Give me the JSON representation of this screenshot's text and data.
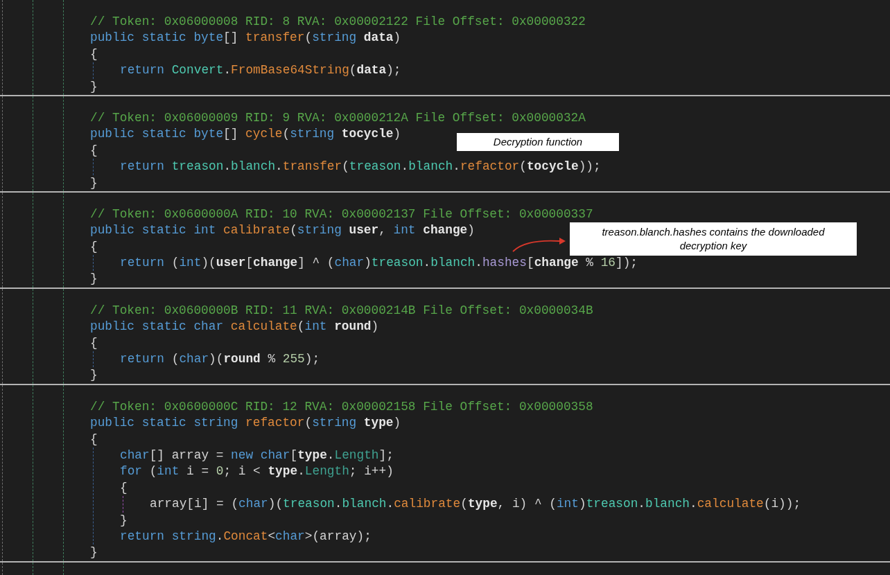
{
  "methods": [
    {
      "comment": "// Token: 0x06000008 RID: 8 RVA: 0x00002122 File Offset: 0x00000322",
      "signature": [
        {
          "kind": "kw",
          "text": "public static byte"
        },
        {
          "kind": "plain",
          "text": "[] "
        },
        {
          "kind": "method",
          "text": "transfer"
        },
        {
          "kind": "plain",
          "text": "("
        },
        {
          "kind": "kw",
          "text": "string "
        },
        {
          "kind": "param",
          "text": "data"
        },
        {
          "kind": "plain",
          "text": ")"
        }
      ],
      "open": "{",
      "close": "}",
      "body": [
        {
          "tokens": [
            {
              "kind": "kw",
              "text": "return "
            },
            {
              "kind": "type",
              "text": "Convert"
            },
            {
              "kind": "plain",
              "text": "."
            },
            {
              "kind": "method",
              "text": "FromBase64String"
            },
            {
              "kind": "plain",
              "text": "("
            },
            {
              "kind": "param",
              "text": "data"
            },
            {
              "kind": "plain",
              "text": ");"
            }
          ]
        }
      ]
    },
    {
      "comment": "// Token: 0x06000009 RID: 9 RVA: 0x0000212A File Offset: 0x0000032A",
      "signature": [
        {
          "kind": "kw",
          "text": "public static byte"
        },
        {
          "kind": "plain",
          "text": "[] "
        },
        {
          "kind": "method",
          "text": "cycle"
        },
        {
          "kind": "plain",
          "text": "("
        },
        {
          "kind": "kw",
          "text": "string "
        },
        {
          "kind": "param",
          "text": "tocycle"
        },
        {
          "kind": "plain",
          "text": ")"
        }
      ],
      "open": "{",
      "close": "}",
      "body": [
        {
          "tokens": [
            {
              "kind": "kw",
              "text": "return "
            },
            {
              "kind": "type",
              "text": "treason"
            },
            {
              "kind": "plain",
              "text": "."
            },
            {
              "kind": "type",
              "text": "blanch"
            },
            {
              "kind": "plain",
              "text": "."
            },
            {
              "kind": "method",
              "text": "transfer"
            },
            {
              "kind": "plain",
              "text": "("
            },
            {
              "kind": "type",
              "text": "treason"
            },
            {
              "kind": "plain",
              "text": "."
            },
            {
              "kind": "type",
              "text": "blanch"
            },
            {
              "kind": "plain",
              "text": "."
            },
            {
              "kind": "method",
              "text": "refactor"
            },
            {
              "kind": "plain",
              "text": "("
            },
            {
              "kind": "param",
              "text": "tocycle"
            },
            {
              "kind": "plain",
              "text": "));"
            }
          ]
        }
      ]
    },
    {
      "comment": "// Token: 0x0600000A RID: 10 RVA: 0x00002137 File Offset: 0x00000337",
      "signature": [
        {
          "kind": "kw",
          "text": "public static int "
        },
        {
          "kind": "method",
          "text": "calibrate"
        },
        {
          "kind": "plain",
          "text": "("
        },
        {
          "kind": "kw",
          "text": "string "
        },
        {
          "kind": "param",
          "text": "user"
        },
        {
          "kind": "plain",
          "text": ", "
        },
        {
          "kind": "kw",
          "text": "int "
        },
        {
          "kind": "param",
          "text": "change"
        },
        {
          "kind": "plain",
          "text": ")"
        }
      ],
      "open": "{",
      "close": "}",
      "body": [
        {
          "tokens": [
            {
              "kind": "kw",
              "text": "return"
            },
            {
              "kind": "plain",
              "text": " ("
            },
            {
              "kind": "kw",
              "text": "int"
            },
            {
              "kind": "plain",
              "text": ")("
            },
            {
              "kind": "param",
              "text": "user"
            },
            {
              "kind": "plain",
              "text": "["
            },
            {
              "kind": "param",
              "text": "change"
            },
            {
              "kind": "plain",
              "text": "] ^ ("
            },
            {
              "kind": "kw",
              "text": "char"
            },
            {
              "kind": "plain",
              "text": ")"
            },
            {
              "kind": "type",
              "text": "treason"
            },
            {
              "kind": "plain",
              "text": "."
            },
            {
              "kind": "type",
              "text": "blanch"
            },
            {
              "kind": "plain",
              "text": "."
            },
            {
              "kind": "field",
              "text": "hashes"
            },
            {
              "kind": "plain",
              "text": "["
            },
            {
              "kind": "param",
              "text": "change"
            },
            {
              "kind": "plain",
              "text": " % "
            },
            {
              "kind": "num",
              "text": "16"
            },
            {
              "kind": "plain",
              "text": "]);"
            }
          ]
        }
      ]
    },
    {
      "comment": "// Token: 0x0600000B RID: 11 RVA: 0x0000214B File Offset: 0x0000034B",
      "signature": [
        {
          "kind": "kw",
          "text": "public static char "
        },
        {
          "kind": "method",
          "text": "calculate"
        },
        {
          "kind": "plain",
          "text": "("
        },
        {
          "kind": "kw",
          "text": "int "
        },
        {
          "kind": "param",
          "text": "round"
        },
        {
          "kind": "plain",
          "text": ")"
        }
      ],
      "open": "{",
      "close": "}",
      "body": [
        {
          "tokens": [
            {
              "kind": "kw",
              "text": "return"
            },
            {
              "kind": "plain",
              "text": " ("
            },
            {
              "kind": "kw",
              "text": "char"
            },
            {
              "kind": "plain",
              "text": ")("
            },
            {
              "kind": "param",
              "text": "round"
            },
            {
              "kind": "plain",
              "text": " % "
            },
            {
              "kind": "num",
              "text": "255"
            },
            {
              "kind": "plain",
              "text": ");"
            }
          ]
        }
      ]
    },
    {
      "comment": "// Token: 0x0600000C RID: 12 RVA: 0x00002158 File Offset: 0x00000358",
      "signature": [
        {
          "kind": "kw",
          "text": "public static string "
        },
        {
          "kind": "method",
          "text": "refactor"
        },
        {
          "kind": "plain",
          "text": "("
        },
        {
          "kind": "kw",
          "text": "string "
        },
        {
          "kind": "param",
          "text": "type"
        },
        {
          "kind": "plain",
          "text": ")"
        }
      ],
      "open": "{",
      "close": "}",
      "body": [
        {
          "tokens": [
            {
              "kind": "kw",
              "text": "char"
            },
            {
              "kind": "plain",
              "text": "[] array = "
            },
            {
              "kind": "kw",
              "text": "new char"
            },
            {
              "kind": "plain",
              "text": "["
            },
            {
              "kind": "param",
              "text": "type"
            },
            {
              "kind": "plain",
              "text": "."
            },
            {
              "kind": "prop",
              "text": "Length"
            },
            {
              "kind": "plain",
              "text": "];"
            }
          ]
        },
        {
          "tokens": [
            {
              "kind": "kw",
              "text": "for"
            },
            {
              "kind": "plain",
              "text": " ("
            },
            {
              "kind": "kw",
              "text": "int"
            },
            {
              "kind": "plain",
              "text": " i = "
            },
            {
              "kind": "num",
              "text": "0"
            },
            {
              "kind": "plain",
              "text": "; i < "
            },
            {
              "kind": "param",
              "text": "type"
            },
            {
              "kind": "plain",
              "text": "."
            },
            {
              "kind": "prop",
              "text": "Length"
            },
            {
              "kind": "plain",
              "text": "; i++)"
            }
          ],
          "open": "{",
          "close": "}",
          "children": [
            {
              "tokens": [
                {
                  "kind": "plain",
                  "text": "array[i] = ("
                },
                {
                  "kind": "kw",
                  "text": "char"
                },
                {
                  "kind": "plain",
                  "text": ")("
                },
                {
                  "kind": "type",
                  "text": "treason"
                },
                {
                  "kind": "plain",
                  "text": "."
                },
                {
                  "kind": "type",
                  "text": "blanch"
                },
                {
                  "kind": "plain",
                  "text": "."
                },
                {
                  "kind": "method",
                  "text": "calibrate"
                },
                {
                  "kind": "plain",
                  "text": "("
                },
                {
                  "kind": "param",
                  "text": "type"
                },
                {
                  "kind": "plain",
                  "text": ", i) ^ ("
                },
                {
                  "kind": "kw",
                  "text": "int"
                },
                {
                  "kind": "plain",
                  "text": ")"
                },
                {
                  "kind": "type",
                  "text": "treason"
                },
                {
                  "kind": "plain",
                  "text": "."
                },
                {
                  "kind": "type",
                  "text": "blanch"
                },
                {
                  "kind": "plain",
                  "text": "."
                },
                {
                  "kind": "method",
                  "text": "calculate"
                },
                {
                  "kind": "plain",
                  "text": "(i));"
                }
              ]
            }
          ]
        },
        {
          "tokens": [
            {
              "kind": "kw",
              "text": "return string"
            },
            {
              "kind": "plain",
              "text": "."
            },
            {
              "kind": "method",
              "text": "Concat"
            },
            {
              "kind": "plain",
              "text": "<"
            },
            {
              "kind": "kw",
              "text": "char"
            },
            {
              "kind": "plain",
              "text": ">(array);"
            }
          ]
        }
      ]
    }
  ],
  "annotations": [
    {
      "text": "Decryption function"
    },
    {
      "text": "treason.blanch.hashes contains the downloaded decryption key"
    }
  ]
}
